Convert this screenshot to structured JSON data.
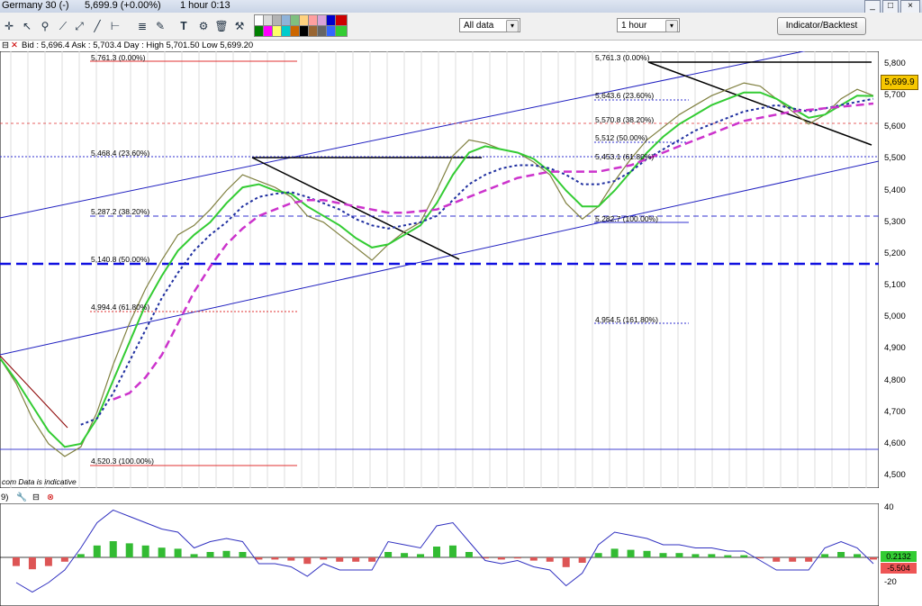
{
  "window": {
    "title_instrument": "Germany 30 (-)",
    "title_price": "5,699.9 (+0.00%)",
    "title_period": "1 hour  0:13",
    "buttons": [
      "_",
      "□",
      "×"
    ]
  },
  "toolbar": {
    "icons": [
      "crosshair-icon",
      "zoom-icon",
      "trend-line-icon",
      "ray-icon",
      "line-icon",
      "arrows-icon",
      "fibonacci-icon",
      "pencil-icon",
      "text-icon",
      "chart-settings-icon",
      "delete-icon",
      "hammer-icon",
      "select-icon"
    ],
    "colors": [
      "#ffffff",
      "#d9d9d9",
      "#b3b3b3",
      "#8fb3d9",
      "#7fbf7f",
      "#ffd27f",
      "#ff9f9f",
      "#d9a3d9",
      "#0000cc",
      "#cc0000",
      "#008000",
      "#ff00ff",
      "#ffff66",
      "#00cccc",
      "#cc6600",
      "#000000",
      "#996633",
      "#666666",
      "#3366ff",
      "#33cc33"
    ],
    "data_range": "All data",
    "period": "1 hour",
    "indicator_button": "Indicator/Backtest"
  },
  "info": {
    "text": "Bid : 5,696.4  Ask : 5,703.4   Day : High 5,701.50  Low 5,699.20"
  },
  "price_axis": {
    "labels": [
      "5,800",
      "5,700",
      "5,600",
      "5,500",
      "5,400",
      "5,300",
      "5,200",
      "5,100",
      "5,000",
      "4,900",
      "4,800",
      "4,700",
      "4,600",
      "4,500"
    ],
    "current": "5,699.9"
  },
  "fib_left": [
    "5,761.3 (0.00%)",
    "5,468.4 (23.60%)",
    "5,287.2 (38.20%)",
    "5,140.8 (50.00%)",
    "4,994.4 (61.80%)",
    "4,520.3 (100.00%)"
  ],
  "fib_right": [
    "5,761.3 (0.00%)",
    "5,643.6 (23.60%)",
    "5,570.8 (38.20%)",
    "5,512 (50.00%)",
    "5,453.1 (61.80%)",
    "5,282.7 (100.00%)",
    "4,954.5 (161.80%)"
  ],
  "source_note": "com  Data is indicative",
  "oscillator": {
    "header": "9)",
    "axis": [
      "40",
      "-20"
    ],
    "values": [
      "0.2132",
      "-5.504"
    ]
  },
  "chart_data": {
    "type": "line",
    "series": [
      {
        "values": [
          4870,
          4790,
          4680,
          4600,
          4560,
          4590,
          4700,
          4850,
          4980,
          5090,
          5180,
          5260,
          5290,
          5340,
          5400,
          5450,
          5430,
          5410,
          5380,
          5320,
          5300,
          5260,
          5220,
          5180,
          5230,
          5270,
          5300,
          5400,
          5510,
          5560,
          5550,
          5530,
          5520,
          5490,
          5450,
          5360,
          5310,
          5350,
          5430,
          5500,
          5560,
          5600,
          5640,
          5670,
          5700,
          5720,
          5740,
          5730,
          5690,
          5650,
          5610,
          5640,
          5690,
          5720,
          5700
        ]
      },
      {
        "values": [
          4870,
          4800,
          4720,
          4640,
          4590,
          4600,
          4680,
          4800,
          4920,
          5040,
          5130,
          5210,
          5260,
          5300,
          5360,
          5410,
          5420,
          5400,
          5390,
          5350,
          5320,
          5290,
          5250,
          5220,
          5230,
          5260,
          5290,
          5360,
          5450,
          5520,
          5540,
          5530,
          5520,
          5500,
          5460,
          5400,
          5350,
          5350,
          5400,
          5460,
          5520,
          5570,
          5610,
          5640,
          5670,
          5690,
          5710,
          5710,
          5690,
          5660,
          5630,
          5640,
          5670,
          5700,
          5699
        ]
      },
      {
        "values": [
          null,
          null,
          null,
          null,
          null,
          4660,
          4680,
          4760,
          4860,
          4960,
          5060,
          5140,
          5210,
          5260,
          5300,
          5350,
          5380,
          5390,
          5395,
          5380,
          5360,
          5340,
          5310,
          5290,
          5280,
          5290,
          5300,
          5320,
          5370,
          5420,
          5450,
          5470,
          5480,
          5480,
          5470,
          5450,
          5420,
          5420,
          5430,
          5460,
          5500,
          5530,
          5560,
          5590,
          5610,
          5630,
          5650,
          5660,
          5670,
          5660,
          5650,
          5660,
          5670,
          5680,
          5690
        ]
      },
      {
        "values": [
          null,
          null,
          null,
          null,
          null,
          null,
          null,
          4740,
          4760,
          4810,
          4880,
          4980,
          5080,
          5160,
          5230,
          5280,
          5320,
          5340,
          5360,
          5370,
          5370,
          5360,
          5350,
          5340,
          5330,
          5330,
          5335,
          5340,
          5360,
          5380,
          5400,
          5420,
          5440,
          5450,
          5460,
          5460,
          5460,
          5460,
          5470,
          5480,
          5500,
          5520,
          5540,
          5560,
          5580,
          5600,
          5620,
          5630,
          5640,
          5650,
          5655,
          5660,
          5665,
          5670,
          5675
        ]
      }
    ],
    "ylim": [
      4460,
      5840
    ],
    "grid": true
  }
}
